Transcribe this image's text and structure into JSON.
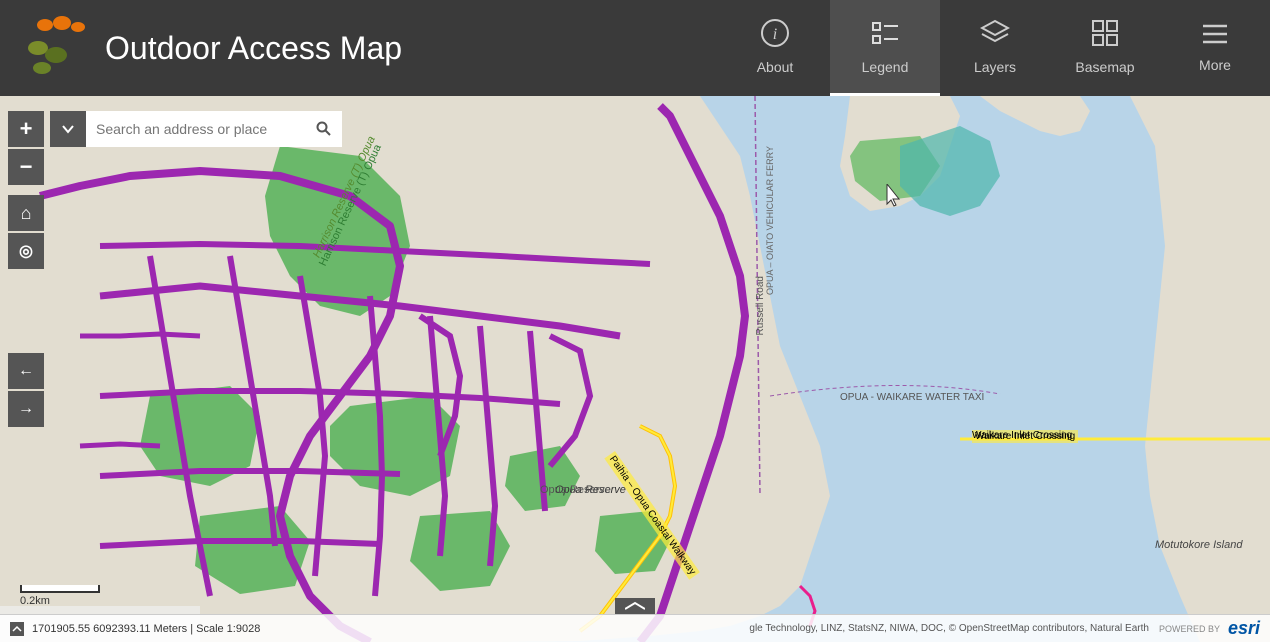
{
  "header": {
    "title": "Outdoor Access Map",
    "logo_alt": "Land Information New Zealand logo"
  },
  "nav": {
    "items": [
      {
        "id": "about",
        "label": "About",
        "icon": "ℹ"
      },
      {
        "id": "legend",
        "label": "Legend",
        "icon": "≡",
        "active": true
      },
      {
        "id": "layers",
        "label": "Layers",
        "icon": "⧖"
      },
      {
        "id": "basemap",
        "label": "Basemap",
        "icon": "⊞"
      },
      {
        "id": "more",
        "label": "More",
        "icon": "≡"
      }
    ]
  },
  "search": {
    "placeholder": "Search an address or place",
    "value": ""
  },
  "controls": {
    "zoom_in": "+",
    "zoom_out": "−",
    "home": "⌂",
    "locate": "◎",
    "back": "←",
    "forward": "→"
  },
  "map_labels": {
    "harrison_reserve": "Harrison Reserve (T) Opua",
    "opua_reserve": "Opua Reserve",
    "russell_road": "Russell Road",
    "opua_oiato": "OPUA – OIATO VEHICULAR FERRY",
    "opua_waikare": "OPUA - WAIKARE WATER TAXI",
    "paihia_coastal": "Paihia – Opua Coastal Walkway",
    "waikare_crossing": "Waikare Inlet Crossing",
    "motutokore_island": "Motutokore Island"
  },
  "bottom_bar": {
    "coordinates": "1701905.55 6092393.11 Meters | Scale 1:9028",
    "attribution": "gle Technology, LINZ, StatsNZ, NIWA, DOC, © OpenStreetMap contributors, Natural Earth",
    "powered_by": "POWERED BY",
    "esri": "esri"
  },
  "scale": {
    "label": "0.2km"
  },
  "colors": {
    "header_bg": "#3a3a3a",
    "map_water": "#a8cfe0",
    "map_land": "#e8e4d8",
    "map_green": "#4caf50",
    "map_purple": "#9c27b0",
    "map_yellow": "#ffeb3b",
    "map_pink": "#e91e8c",
    "nav_active_border": "#ffffff"
  }
}
